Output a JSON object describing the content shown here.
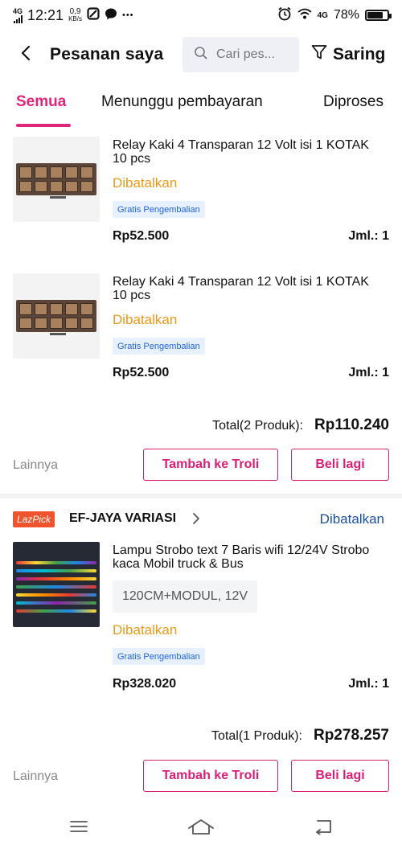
{
  "status_bar": {
    "network": "4G",
    "time": "12:21",
    "speed_value": "0,9",
    "speed_unit": "KB/s",
    "more": "•••",
    "right_network": "4G",
    "battery": "78%",
    "battery_level": 0.78
  },
  "header": {
    "title": "Pesanan saya",
    "search_placeholder": "Cari pes...",
    "filter_label": "Saring"
  },
  "tabs": [
    {
      "label": "Semua",
      "active": true
    },
    {
      "label": "Menunggu pembayaran",
      "active": false
    },
    {
      "label": "Diproses",
      "active": false
    }
  ],
  "order1": {
    "items": [
      {
        "title": "Relay Kaki 4 Transparan 12 Volt isi 1 KOTAK 10 pcs",
        "status": "Dibatalkan",
        "badge": "Gratis Pengembalian",
        "price": "Rp52.500",
        "qty": "Jml.: 1"
      },
      {
        "title": "Relay Kaki 4 Transparan 12 Volt isi 1 KOTAK 10 pcs",
        "status": "Dibatalkan",
        "badge": "Gratis Pengembalian",
        "price": "Rp52.500",
        "qty": "Jml.: 1"
      }
    ],
    "total_label": "Total(2 Produk):",
    "total_value": "Rp110.240",
    "more_label": "Lainnya",
    "cart_button": "Tambah ke Troli",
    "buy_again_button": "Beli lagi"
  },
  "order2": {
    "store_badge": "LazPick",
    "store_name": "EF-JAYA VARIASI",
    "order_status": "Dibatalkan",
    "item": {
      "title": "Lampu Strobo text 7 Baris wifi 12/24V Strobo kaca Mobil truck & Bus",
      "variant": "120CM+MODUL, 12V",
      "status": "Dibatalkan",
      "badge": "Gratis Pengembalian",
      "price": "Rp328.020",
      "qty": "Jml.: 1"
    },
    "total_label": "Total(1 Produk):",
    "total_value": "Rp278.257",
    "more_label": "Lainnya",
    "cart_button": "Tambah ke Troli",
    "buy_again_button": "Beli lagi"
  },
  "colors": {
    "accent": "#e0257d",
    "status_cancelled": "#e89a18",
    "store_status": "#1a4fa8",
    "badge_text": "#2365d8",
    "lazpick": "#f0542c"
  },
  "icons": {
    "back": "chevron-left-icon",
    "search": "search-icon",
    "filter": "filter-funnel-icon",
    "store_chevron": "chevron-right-icon",
    "nav_menu": "menu-icon",
    "nav_home": "home-icon",
    "nav_back": "back-icon"
  }
}
